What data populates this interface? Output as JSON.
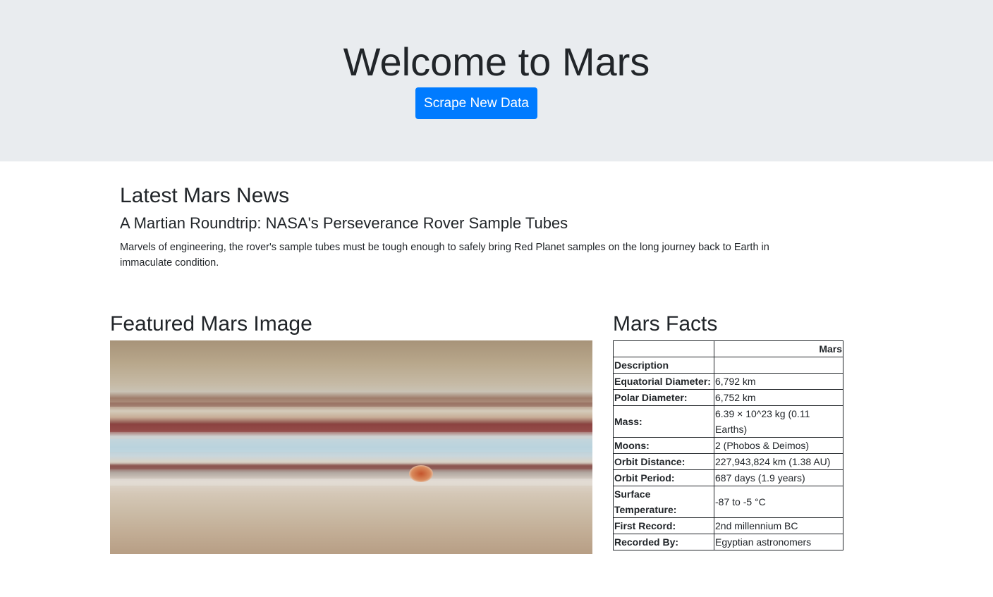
{
  "header": {
    "title": "Welcome to Mars",
    "scrape_button": "Scrape New Data"
  },
  "news": {
    "section_title": "Latest Mars News",
    "headline": "A Martian Roundtrip: NASA's Perseverance Rover Sample Tubes",
    "teaser": "Marvels of engineering, the rover's sample tubes must be tough enough to safely bring Red Planet samples on the long journey back to Earth in immaculate condition."
  },
  "featured": {
    "section_title": "Featured Mars Image"
  },
  "facts": {
    "section_title": "Mars Facts",
    "column_header_left": "",
    "column_header_right": "Mars",
    "rows": [
      {
        "label": "Description",
        "value": ""
      },
      {
        "label": "Equatorial Diameter:",
        "value": "6,792 km"
      },
      {
        "label": "Polar Diameter:",
        "value": "6,752 km"
      },
      {
        "label": "Mass:",
        "value": "6.39 × 10^23 kg (0.11 Earths)"
      },
      {
        "label": "Moons:",
        "value": "2 (Phobos & Deimos)"
      },
      {
        "label": "Orbit Distance:",
        "value": "227,943,824 km (1.38 AU)"
      },
      {
        "label": "Orbit Period:",
        "value": "687 days (1.9 years)"
      },
      {
        "label": "Surface Temperature:",
        "value": "-87 to -5 °C"
      },
      {
        "label": "First Record:",
        "value": "2nd millennium BC"
      },
      {
        "label": "Recorded By:",
        "value": "Egyptian astronomers"
      }
    ]
  }
}
